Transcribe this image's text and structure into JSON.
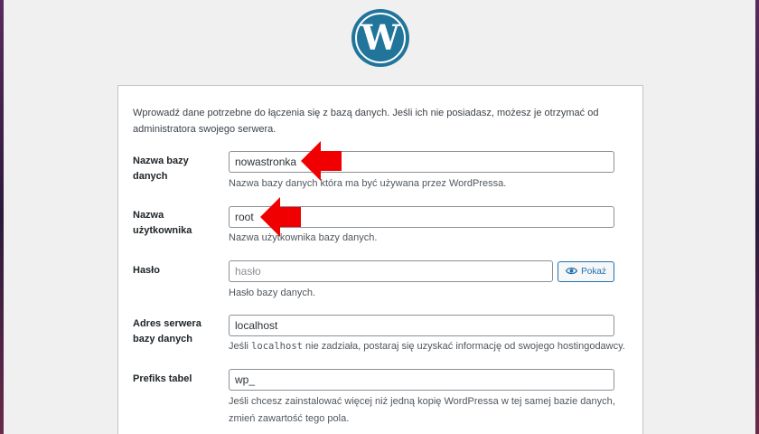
{
  "colors": {
    "brand_blue": "#2271b1",
    "logo_blue": "#21759b",
    "arrow_red": "#f00000",
    "panel_bg": "#ffffff",
    "page_bg": "#f0f0f1"
  },
  "header": {
    "logo_icon": "wordpress-logo-icon"
  },
  "intro_text": "Wprowadź dane potrzebne do łączenia się z bazą danych. Jeśli ich nie posiadasz, możesz je otrzymać od administratora swojego serwera.",
  "fields": {
    "dbname": {
      "label_line1": "Nazwa bazy",
      "label_line2": "danych",
      "value": "nowastronka",
      "description": "Nazwa bazy danych która ma być używana przez WordPressa."
    },
    "username": {
      "label_line1": "Nazwa",
      "label_line2": "użytkownika",
      "value": "root",
      "description": "Nazwa użytkownika bazy danych."
    },
    "password": {
      "label": "Hasło",
      "placeholder": "hasło",
      "description": "Hasło bazy danych.",
      "show_button": "Pokaż",
      "show_icon": "eye-icon"
    },
    "host": {
      "label_line1": "Adres serwera",
      "label_line2": "bazy danych",
      "value": "localhost",
      "description_pre": "Jeśli",
      "description_code": "localhost",
      "description_post": "nie zadziała, postaraj się uzyskać informację od swojego hostingodawcy."
    },
    "prefix": {
      "label": "Prefiks tabel",
      "value": "wp_",
      "description_line1": "Jeśli chcesz zainstalować więcej niż jedną kopię WordPressa w tej samej bazie danych,",
      "description_line2": "zmień zawartość tego pola."
    }
  },
  "annotations": {
    "arrow_icon": "red-arrow-icon"
  }
}
